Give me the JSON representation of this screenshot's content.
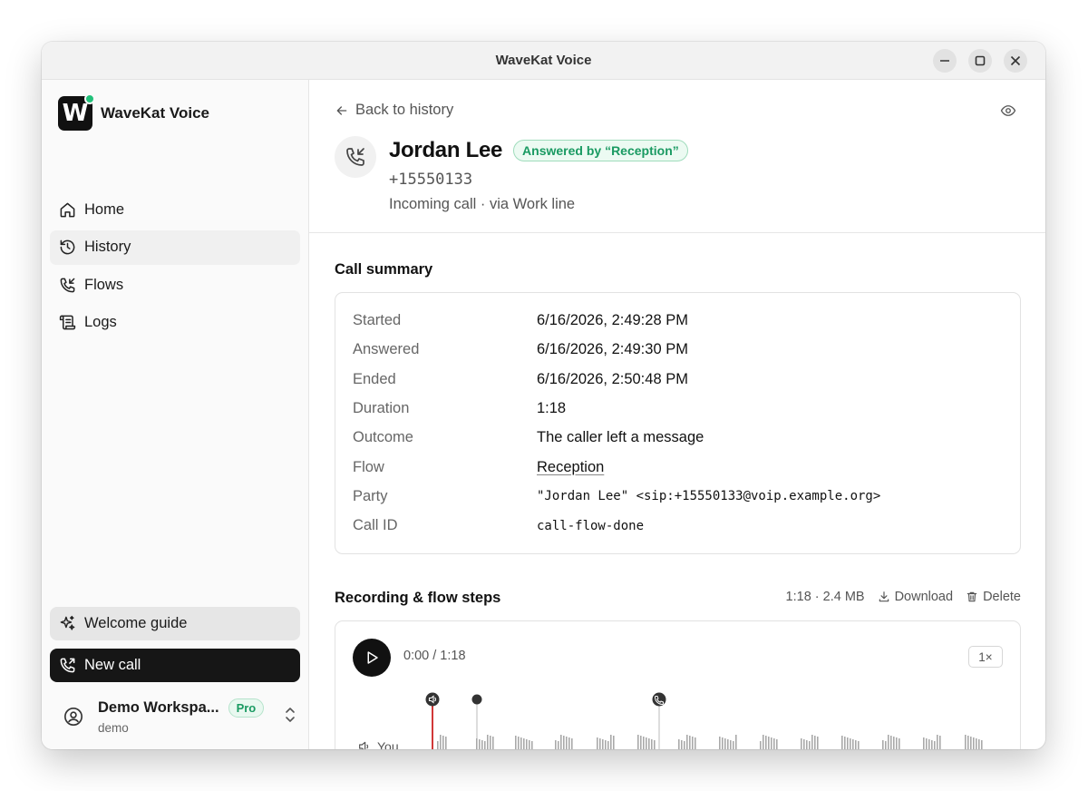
{
  "window": {
    "title": "WaveKat Voice"
  },
  "brand": {
    "logo_letter": "W",
    "name": "WaveKat Voice"
  },
  "nav": [
    {
      "label": "Home",
      "icon": "home-icon",
      "active": false
    },
    {
      "label": "History",
      "icon": "history-icon",
      "active": true
    },
    {
      "label": "Flows",
      "icon": "flows-icon",
      "active": false
    },
    {
      "label": "Logs",
      "icon": "logs-icon",
      "active": false
    }
  ],
  "sidebar_bottom": {
    "guide_label": "Welcome guide",
    "new_call_label": "New call",
    "workspace": {
      "name": "Demo Workspa...",
      "badge": "Pro",
      "sub": "demo"
    }
  },
  "detail": {
    "back_label": "Back to history",
    "contact_name": "Jordan Lee",
    "status_badge": "Answered by “Reception”",
    "phone": "+15550133",
    "meta": "Incoming call · via Work line"
  },
  "summary": {
    "title": "Call summary",
    "rows": [
      {
        "key": "Started",
        "value": "6/16/2026, 2:49:28 PM"
      },
      {
        "key": "Answered",
        "value": "6/16/2026, 2:49:30 PM"
      },
      {
        "key": "Ended",
        "value": "6/16/2026, 2:50:48 PM"
      },
      {
        "key": "Duration",
        "value": "1:18"
      },
      {
        "key": "Outcome",
        "value": "The caller left a message"
      },
      {
        "key": "Flow",
        "value": "Reception"
      },
      {
        "key": "Party",
        "value": "\"Jordan Lee\" <sip:+15550133@voip.example.org>"
      },
      {
        "key": "Call ID",
        "value": "call-flow-done"
      }
    ]
  },
  "recording": {
    "title": "Recording & flow steps",
    "info": "1:18 · 2.4 MB",
    "download_label": "Download",
    "delete_label": "Delete",
    "time_display": "0:00 / 1:18",
    "speed": "1×",
    "track_label": "You",
    "progress": 0
  },
  "colors": {
    "accent_green": "#22c17a",
    "badge_green_text": "#1a9a62",
    "playhead_red": "#cc2222"
  }
}
